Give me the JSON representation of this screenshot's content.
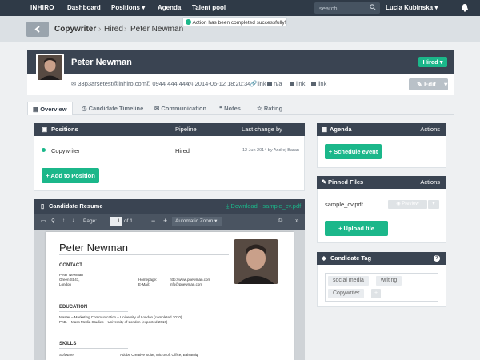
{
  "nav": {
    "logo": "INHIRO",
    "items": [
      "Dashboard",
      "Positions ▾",
      "Agenda",
      "Talent pool"
    ],
    "search_placeholder": "search...",
    "user": "Lucia Kubinska ▾"
  },
  "toast": "Action has been completed successfully!",
  "breadcrumb": {
    "root": "Copywriter",
    "sep": "›",
    "mid": "Hired",
    "leaf": "Peter Newman"
  },
  "profile": {
    "name": "Peter Newman",
    "status": "Hired ▾",
    "email": "33p3arsetest@inhiro.com",
    "phone": "0944 444 444",
    "date": "2014-06-12 18:20:34",
    "link1": "link",
    "na": "n/a",
    "link2": "link",
    "link3": "link",
    "edit": "Edit"
  },
  "tabs": [
    "Overview",
    "Candidate Timeline",
    "Communication",
    "Notes",
    "Rating"
  ],
  "positions": {
    "title": "Positions",
    "col_pipeline": "Pipeline",
    "col_last": "Last change by",
    "row": {
      "name": "Copywriter",
      "stage": "Hired",
      "changed": "12 Jun 2014 by Andrej Baran"
    },
    "add_btn": "+ Add to Position"
  },
  "resume": {
    "title": "Candidate Resume",
    "download": "Download - sample_cv.pdf",
    "page_label": "Page:",
    "page": "1",
    "of": "of 1",
    "zoom": "Automatic Zoom ▾"
  },
  "cv": {
    "name": "Peter Newman",
    "contact_h": "CONTACT",
    "addr1": "Peter Newman",
    "addr2": "Green St 41,",
    "addr3": "London",
    "homepage_l": "Homepage:",
    "homepage_v": "http://www.pnewman.com",
    "email_l": "E-Mail:",
    "email_v": "info@pnewman.com",
    "edu_h": "EDUCATION",
    "edu1": "Master – Marketing Communication – University of London (completed 2010)",
    "edu2": "PhD. – Mass Media Studies – University of London (expected 2016)",
    "skills_h": "SKILLS",
    "skills_l": "Software:",
    "skills_v": "Adobe Creative Suite, Microsoft Office, Balsamiq"
  },
  "agenda": {
    "title": "Agenda",
    "actions": "Actions",
    "btn": "+ Schedule event"
  },
  "files": {
    "title": "Pinned Files",
    "actions": "Actions",
    "file": "sample_cv.pdf",
    "preview": "Preview",
    "upload": "+ Upload file"
  },
  "tags": {
    "title": "Candidate Tag",
    "items": [
      "social media",
      "writing",
      "Copywriter"
    ],
    "add": "+"
  }
}
